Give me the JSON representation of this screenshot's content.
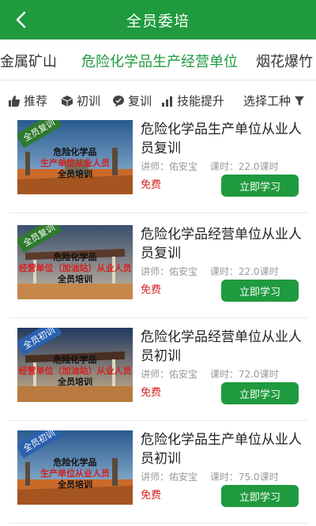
{
  "header": {
    "title": "全员委培"
  },
  "categories": [
    "非金属矿山",
    "危险化学品生产经营单位",
    "烟花爆竹"
  ],
  "active_category_index": 1,
  "filters": [
    {
      "label": "推荐",
      "icon": "thumbs-up-icon"
    },
    {
      "label": "初训",
      "icon": "cube-icon"
    },
    {
      "label": "复训",
      "icon": "chat-bubble-icon"
    },
    {
      "label": "技能提升",
      "icon": "bar-chart-icon"
    },
    {
      "label": "选择工种",
      "icon": "filter-funnel-icon"
    }
  ],
  "courses": [
    {
      "badge": "全员复训",
      "thumb_lines": [
        "危险化学品",
        "生产单位从业人员",
        "全员培训"
      ],
      "title": "危险化学品生产单位从业人员复训",
      "teacher": "讲师：佑安宝",
      "hours": "课时：22.0课时",
      "price": "免费",
      "button": "立即学习"
    },
    {
      "badge": "全员复训",
      "thumb_lines": [
        "危险化学品",
        "经营单位（加油站）从业人员",
        "全员培训"
      ],
      "title": "危险化学品经营单位从业人员复训",
      "teacher": "讲师：佑安宝",
      "hours": "课时：22.0课时",
      "price": "免费",
      "button": "立即学习"
    },
    {
      "badge": "全员初训",
      "thumb_lines": [
        "危险化学品",
        "经营单位（加油站）从业人员",
        "全员培训"
      ],
      "title": "危险化学品经营单位从业人员初训",
      "teacher": "讲师：佑安宝",
      "hours": "课时：72.0课时",
      "price": "免费",
      "button": "立即学习"
    },
    {
      "badge": "全员初训",
      "thumb_lines": [
        "危险化学品",
        "生产单位从业人员",
        "全员培训"
      ],
      "title": "危险化学品生产单位从业人员初训",
      "teacher": "讲师：佑安宝",
      "hours": "课时：75.0课时",
      "price": "免费",
      "button": "立即学习"
    }
  ],
  "colors": {
    "primary": "#1f9a3e",
    "price": "#d61f1f",
    "muted": "#999999"
  }
}
